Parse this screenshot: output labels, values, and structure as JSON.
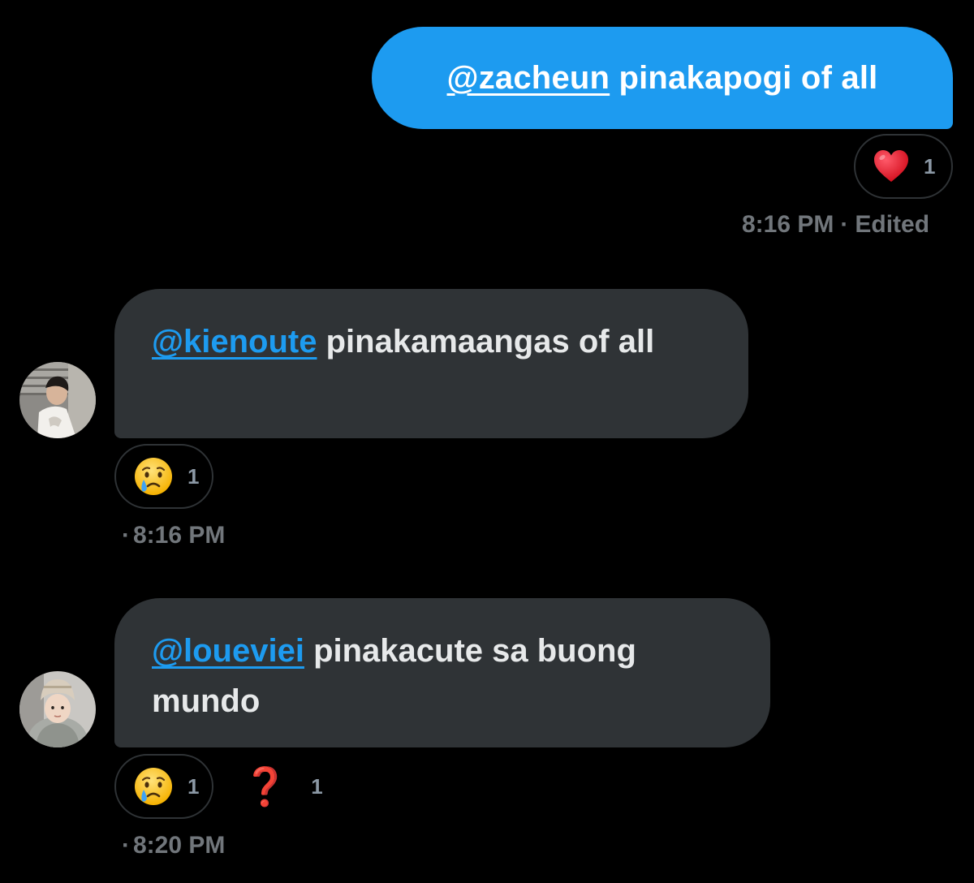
{
  "messages": [
    {
      "direction": "sent",
      "mention": "@zacheun",
      "text": " pinakapogi of all",
      "reactions": [
        {
          "emoji": "heart-emoji",
          "count": "1"
        }
      ],
      "time": "8:16 PM",
      "separator": "·",
      "status": "Edited"
    },
    {
      "direction": "received",
      "mention": "@kienoute",
      "text": " pinakamaangas of all",
      "reactions": [
        {
          "emoji": "crying-face-emoji",
          "count": "1"
        }
      ],
      "separator": "·",
      "time": "8:16 PM"
    },
    {
      "direction": "received",
      "mention": "@loueviei",
      "text": " pinakacute sa buong mundo",
      "reactions": [
        {
          "emoji": "crying-face-emoji",
          "count": "1"
        },
        {
          "emoji": "question-mark-emoji",
          "glyph": "❓",
          "count": "1"
        }
      ],
      "separator": "·",
      "time": "8:20 PM"
    }
  ],
  "colors": {
    "background": "#000000",
    "sent_bubble": "#1d9bf0",
    "received_bubble": "#2f3336",
    "mention_link": "#1d9bf0",
    "meta_text": "#71767b",
    "heart": "#e0162b",
    "question": "#d9141d"
  }
}
